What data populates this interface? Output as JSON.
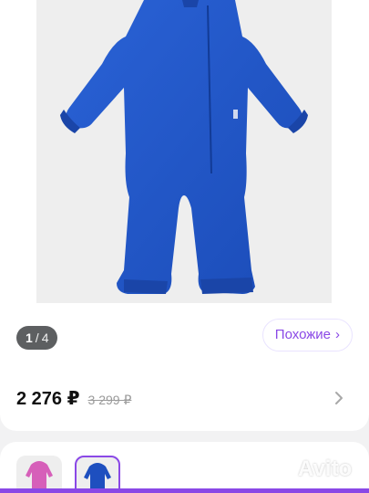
{
  "gallery": {
    "current": "1",
    "separator": "/",
    "total": "4"
  },
  "similar_button": {
    "label": "Похожие",
    "chevron": "›"
  },
  "pricing": {
    "price": "2 276 ₽",
    "old_price": "3 299 ₽"
  },
  "product_image": {
    "description_icon": "blue-fleece-jumpsuit",
    "color": "#2255c8"
  },
  "thumbnails": [
    {
      "color": "#d65fb9",
      "icon": "pink-jumpsuit-thumbnail"
    },
    {
      "color": "#1e4fbf",
      "icon": "blue-jumpsuit-thumbnail"
    }
  ],
  "watermark": {
    "text": "Avito"
  },
  "colors": {
    "accent": "#8a48e6",
    "price": "#111111",
    "old_price": "#9a9a9a"
  }
}
